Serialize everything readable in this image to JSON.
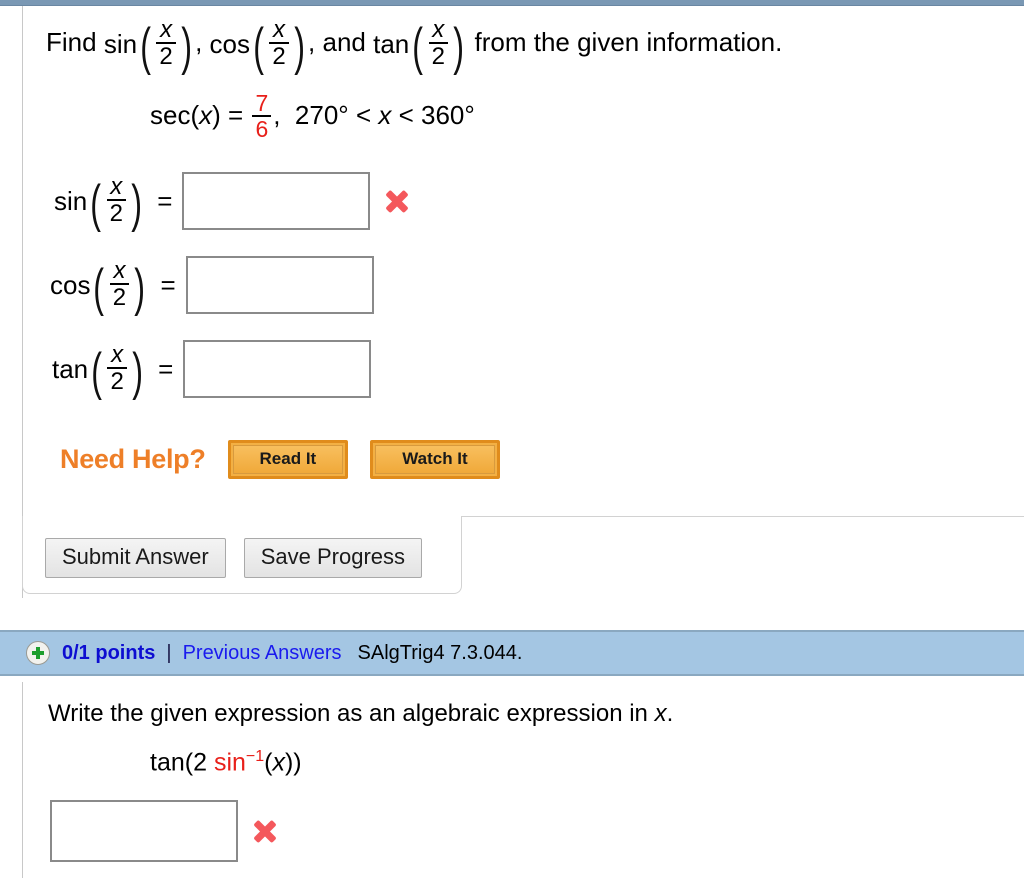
{
  "problem1": {
    "prompt_prefix": "Find",
    "prompt_suffix": "from the given information.",
    "comma": ",",
    "and": ", and",
    "functions": {
      "sin": "sin",
      "cos": "cos",
      "tan": "tan",
      "sec": "sec"
    },
    "half_angle": {
      "numerator": "x",
      "denominator": "2"
    },
    "given": {
      "lhs": "sec(",
      "lhs_var": "x",
      "lhs_close": ") =",
      "fraction_numerator": "7",
      "fraction_denominator": "6",
      "fraction_color": "#e8201a",
      "trailing_comma": ",",
      "domain": "270° < x < 360°",
      "domain_lower": "270°",
      "domain_var": "x",
      "domain_upper": "360°",
      "lt": "<"
    },
    "equals": "=",
    "answers": [
      {
        "function": "sin",
        "value": "",
        "placeholder": "",
        "mark": "incorrect"
      },
      {
        "function": "cos",
        "value": "",
        "placeholder": "",
        "mark": "none"
      },
      {
        "function": "tan",
        "value": "",
        "placeholder": "",
        "mark": "none"
      }
    ],
    "need_help": {
      "label": "Need Help?",
      "buttons": [
        {
          "label": "Read It"
        },
        {
          "label": "Watch It"
        }
      ],
      "label_color": "#ee7f28"
    },
    "actions": {
      "submit_label": "Submit Answer",
      "save_label": "Save Progress"
    }
  },
  "points_bar": {
    "icon": "plus-circle-icon",
    "points": "0/1 points",
    "separator": "|",
    "previous_answers_link": "Previous Answers",
    "problem_id": "SAlgTrig4 7.3.044.",
    "background_color": "#a4c6e3",
    "points_color": "#0d0dd1",
    "link_color": "#1a1aee"
  },
  "problem2": {
    "prompt_prefix": "Write the given expression as an algebraic expression in",
    "prompt_var": "x",
    "prompt_period": ".",
    "expression": {
      "prefix": "tan(2 ",
      "inverse_fn": "sin",
      "exponent": "−1",
      "suffix_open": "(",
      "variable": "x",
      "suffix_close": "))",
      "inverse_color": "#e8201a"
    },
    "answer": {
      "value": "",
      "placeholder": "",
      "mark": "incorrect"
    }
  },
  "colors": {
    "top_rule": "#7a98b4",
    "x_mark": "#f4585c",
    "input_border": "#8a8a8a",
    "help_button": "#f3b044"
  }
}
